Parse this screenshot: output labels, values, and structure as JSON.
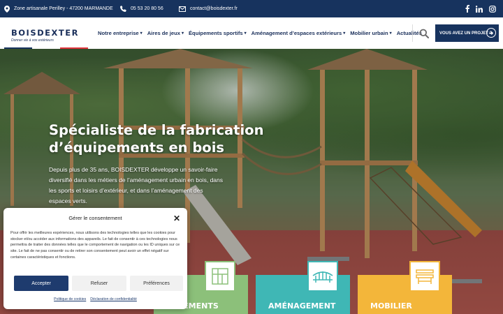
{
  "topbar": {
    "address": "Zone artisanale Perilley - 47200 MARMANDE",
    "phone": "05 53 20 80 56",
    "email": "contact@boisdexter.fr",
    "social": [
      "facebook",
      "linkedin",
      "instagram"
    ]
  },
  "brand": {
    "name": "BOISDEXTER",
    "tagline": "Donner vie à vos extérieurs",
    "colors": {
      "navy": "#17335e",
      "stripe_blue": "#17335e",
      "stripe_white": "#ffffff",
      "stripe_red": "#e0323a",
      "green": "#8cc07a",
      "teal": "#3fb7b5",
      "yellow": "#f3b63a"
    }
  },
  "nav": {
    "items": [
      {
        "label": "Notre entreprise",
        "dropdown": true
      },
      {
        "label": "Aires de jeux",
        "dropdown": true
      },
      {
        "label": "Équipements sportifs",
        "dropdown": true
      },
      {
        "label": "Aménagement d’espaces extérieurs",
        "dropdown": true
      },
      {
        "label": "Mobilier urbain",
        "dropdown": true
      },
      {
        "label": "Actualités",
        "dropdown": false
      }
    ],
    "cta": "VOUS AVEZ UN PROJET ?"
  },
  "hero": {
    "title": "Spécialiste de la fabrication d’équipements en bois",
    "text": "Depuis plus de 35 ans, BOISDEXTER développe un savoir-faire diversifié dans les métiers de l’aménagement urbain en bois, dans les sports et loisirs d’extérieur, et dans l’aménagement des espaces verts."
  },
  "tiles": [
    {
      "label": "ÉQUIPEMENTS",
      "visible_label": "IPEMENTS",
      "color": "#8cc07a",
      "icon": "sports-equipment-icon"
    },
    {
      "label": "AMÉNAGEMENT",
      "color": "#3fb7b5",
      "icon": "bridge-icon"
    },
    {
      "label": "MOBILIER",
      "color": "#f3b63a",
      "icon": "bench-icon"
    }
  ],
  "consent": {
    "title": "Gérer le consentement",
    "body": "Pour offrir les meilleures expériences, nous utilisons des technologies telles que les cookies pour stocker et/ou accéder aux informations des appareils. Le fait de consentir à ces technologies nous permettra de traiter des données telles que le comportement de navigation ou les ID uniques sur ce site. Le fait de ne pas consentir ou de retirer son consentement peut avoir un effet négatif sur certaines caractéristiques et fonctions.",
    "accept": "Accepter",
    "refuse": "Refuser",
    "preferences": "Préférences",
    "links": [
      "Politique de cookies",
      "Déclaration de confidentialité"
    ]
  }
}
